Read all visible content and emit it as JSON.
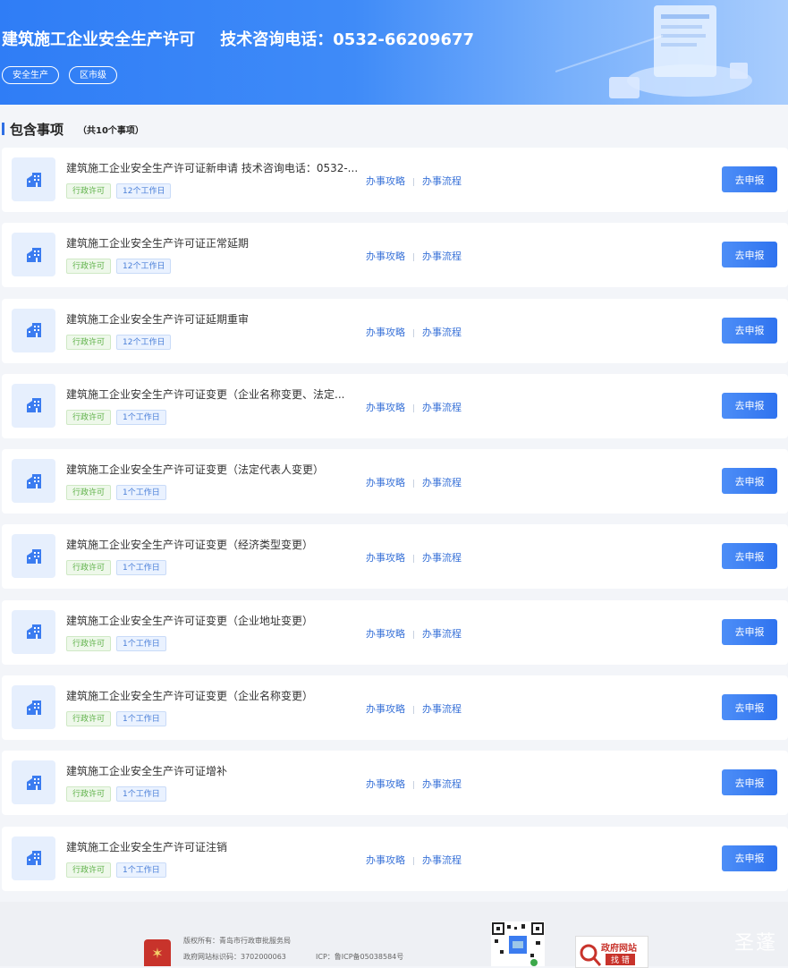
{
  "banner": {
    "title": "建筑施工企业安全生产许可",
    "phone": "技术咨询电话：0532-66209677",
    "tags": [
      "安全生产",
      "区市级"
    ]
  },
  "section": {
    "title": "包含事项",
    "count": "（共10个事项）"
  },
  "links": {
    "guide": "办事攻略",
    "sep": "|",
    "flow": "办事流程"
  },
  "apply_label": "去申报",
  "items": [
    {
      "title": "建筑施工企业安全生产许可证新申请 技术咨询电话：0532-...",
      "type": "行政许可",
      "days": "12个工作日"
    },
    {
      "title": "建筑施工企业安全生产许可证正常延期",
      "type": "行政许可",
      "days": "12个工作日"
    },
    {
      "title": "建筑施工企业安全生产许可证延期重审",
      "type": "行政许可",
      "days": "12个工作日"
    },
    {
      "title": "建筑施工企业安全生产许可证变更（企业名称变更、法定...",
      "type": "行政许可",
      "days": "1个工作日"
    },
    {
      "title": "建筑施工企业安全生产许可证变更（法定代表人变更）",
      "type": "行政许可",
      "days": "1个工作日"
    },
    {
      "title": "建筑施工企业安全生产许可证变更（经济类型变更）",
      "type": "行政许可",
      "days": "1个工作日"
    },
    {
      "title": "建筑施工企业安全生产许可证变更（企业地址变更）",
      "type": "行政许可",
      "days": "1个工作日"
    },
    {
      "title": "建筑施工企业安全生产许可证变更（企业名称变更）",
      "type": "行政许可",
      "days": "1个工作日"
    },
    {
      "title": "建筑施工企业安全生产许可证增补",
      "type": "行政许可",
      "days": "1个工作日"
    },
    {
      "title": "建筑施工企业安全生产许可证注销",
      "type": "行政许可",
      "days": "1个工作日"
    }
  ],
  "footer": {
    "copyright": "版权所有：青岛市行政审批服务局",
    "site_id": "政府网站标识码：3702000063",
    "icp": "ICP：鲁ICP备05038584号",
    "gov_badge_line1": "政府网站",
    "gov_badge_line2": "找 错",
    "watermark": "圣蓬"
  },
  "colors": {
    "primary": "#2f73ef",
    "green_tag": "#5fb249",
    "blue_tag": "#4a7fd8"
  }
}
